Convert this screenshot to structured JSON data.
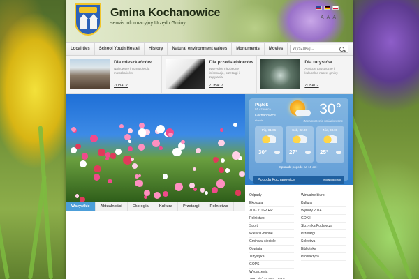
{
  "site": {
    "title": "Gmina Kochanowice",
    "subtitle": "serwis informacyjny Urzędu Gminy"
  },
  "font_sizes": [
    "A",
    "A",
    "A"
  ],
  "nav": {
    "items": [
      "Localities",
      "School Youth Hostel",
      "History",
      "Natural environment values",
      "Monuments",
      "Movies"
    ],
    "search_placeholder": "Wyszukaj..."
  },
  "promos": [
    {
      "title": "Dla mieszkańców",
      "text": "Najnowsze informacje dla mieszkańców.",
      "link": "ZOBACZ"
    },
    {
      "title": "Dla przedsiębiorców",
      "text": "Wszystkie niezbędne informacje, przetargi i zapytania.",
      "link": "ZOBACZ"
    },
    {
      "title": "Dla turystów",
      "text": "Atrakcje turystyczne i kulturalne naszej gminy.",
      "link": "ZOBACZ"
    }
  ],
  "tabs": [
    "Wszystkie",
    "Aktualności",
    "Ekologia",
    "Kultura",
    "Przetargi",
    "Rolnictwo"
  ],
  "weather": {
    "day": "Piątek",
    "date": "01 czerwca",
    "city": "Kochanowice",
    "region": "śląskie",
    "temp": "30°",
    "desc": "Zachmurzenie umiarkowane",
    "forecast": [
      {
        "label": "Pią, 01.06",
        "temp": "30°"
      },
      {
        "label": "Sob, 02.06",
        "temp": "27°"
      },
      {
        "label": "Nie, 03.06",
        "temp": "25°"
      }
    ],
    "more": "Sprawdź pogodę na 16 dni ›",
    "footer": "Pogoda Kochanowice",
    "brand": "twojapogoda.pl"
  },
  "links": {
    "left": [
      "Odpady",
      "Ekologia",
      "ZDG ZDSP RP",
      "Rolnictwo",
      "Sport",
      "Wieści Gminne",
      "Gmina w sieciole",
      "Oświata",
      "Turystyka",
      "GOPS",
      "Wydarzenia",
      "JAKOŚĆ POWIETRZA"
    ],
    "right": [
      "Wirtualne biuro",
      "Kultura",
      "Wybory 2014",
      "GOKiI",
      "Skrzynka Podawcza",
      "Przetargi",
      "Sołectwa",
      "Biblioteka",
      "Profilaktyka"
    ]
  },
  "colors": {
    "accent": "#4c9ed9",
    "weather": "#2f7dc9"
  }
}
